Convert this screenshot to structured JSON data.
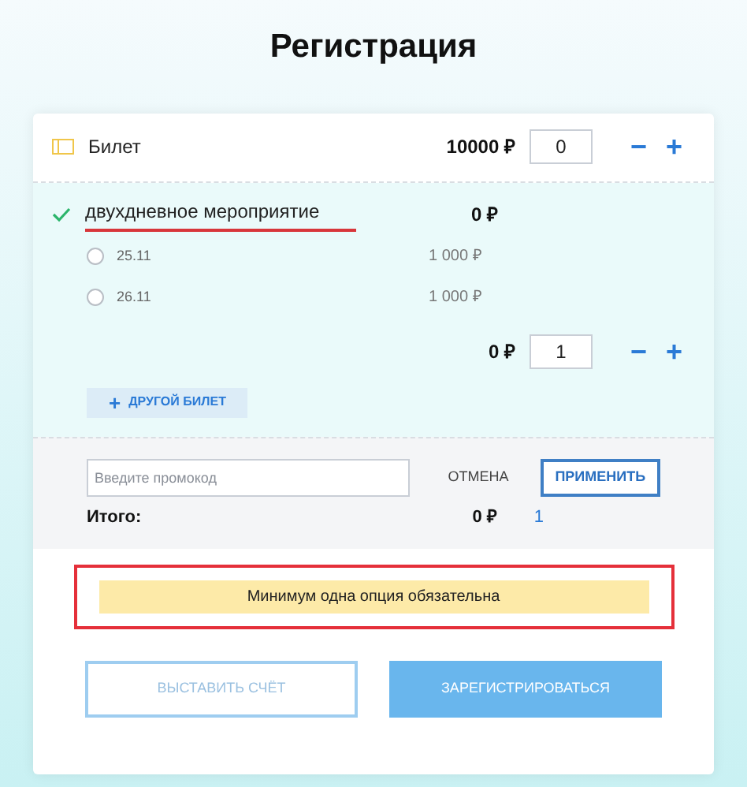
{
  "title": "Регистрация",
  "ticket": {
    "name": "Билет",
    "price": "10000 ₽",
    "quantity": "0",
    "minus": "−",
    "plus": "+"
  },
  "selection": {
    "checked": true,
    "name": "двухдневное мероприятие",
    "price": "0 ₽",
    "underlined": true,
    "options": [
      {
        "label": "25.11",
        "price": "1 000 ₽",
        "selected": false
      },
      {
        "label": "26.11",
        "price": "1 000 ₽",
        "selected": false
      }
    ],
    "subtotal": "0 ₽",
    "quantity": "1",
    "minus": "−",
    "plus": "+"
  },
  "add_ticket": {
    "icon": "+",
    "label": "ДРУГОЙ БИЛЕТ"
  },
  "promo": {
    "placeholder": "Введите промокод",
    "cancel": "ОТМЕНА",
    "apply": "ПРИМЕНИТЬ"
  },
  "total": {
    "label": "Итого:",
    "price": "0 ₽",
    "count": "1"
  },
  "alert": {
    "text": "Минимум одна опция обязательна",
    "outlined": true
  },
  "buttons": {
    "invoice": "ВЫСТАВИТЬ СЧЁТ",
    "register": "ЗАРЕГИСТРИРОВАТЬСЯ"
  }
}
